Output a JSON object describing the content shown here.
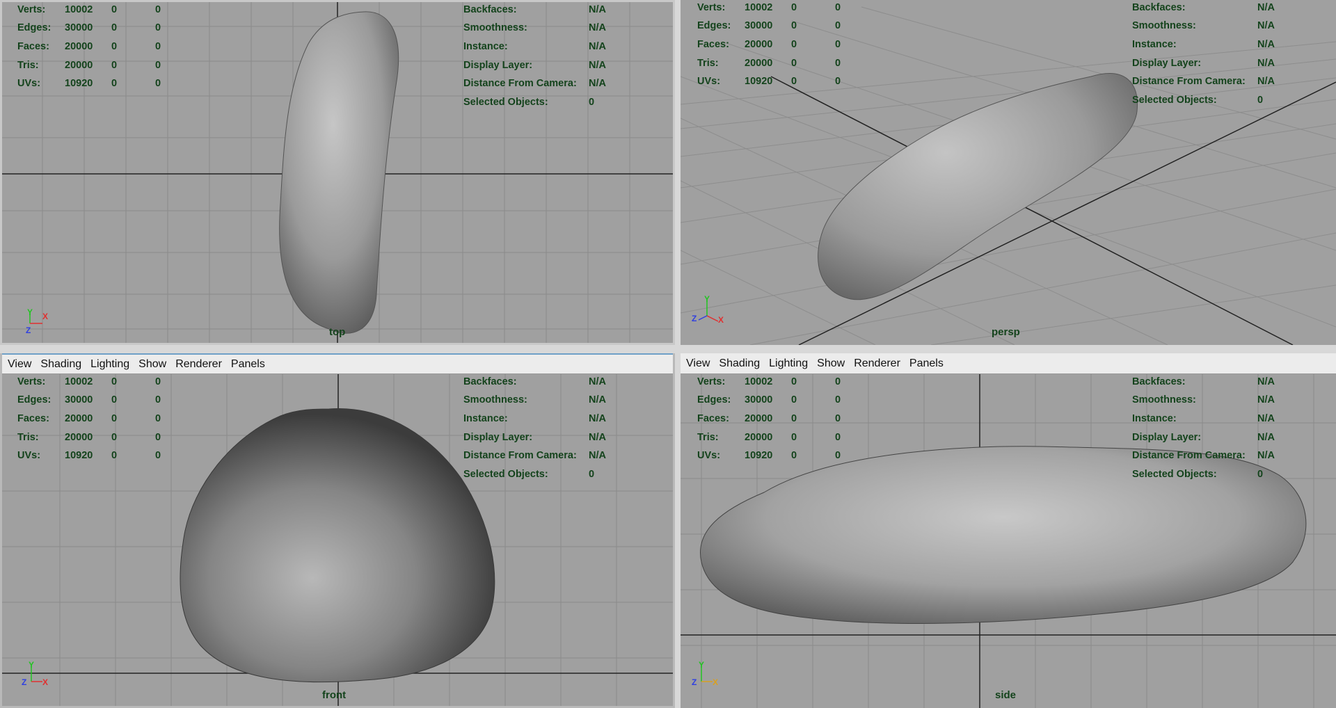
{
  "menu": [
    "View",
    "Shading",
    "Lighting",
    "Show",
    "Renderer",
    "Panels"
  ],
  "poly_stats": [
    {
      "label": "Verts:",
      "values": [
        "10002",
        "0",
        "0"
      ]
    },
    {
      "label": "Edges:",
      "values": [
        "30000",
        "0",
        "0"
      ]
    },
    {
      "label": "Faces:",
      "values": [
        "20000",
        "0",
        "0"
      ]
    },
    {
      "label": "Tris:",
      "values": [
        "20000",
        "0",
        "0"
      ]
    },
    {
      "label": "UVs:",
      "values": [
        "10920",
        "0",
        "0"
      ]
    }
  ],
  "display_stats": [
    {
      "label": "Backfaces:",
      "value": "N/A"
    },
    {
      "label": "Smoothness:",
      "value": "N/A"
    },
    {
      "label": "Instance:",
      "value": "N/A"
    },
    {
      "label": "Display Layer:",
      "value": "N/A"
    },
    {
      "label": "Distance From Camera:",
      "value": "N/A"
    },
    {
      "label": "Selected Objects:",
      "value": "0"
    }
  ],
  "viewports": {
    "top": {
      "camera": "top",
      "axes": [
        "Y",
        "X",
        "Z"
      ]
    },
    "persp": {
      "camera": "persp",
      "axes": [
        "Y",
        "Z",
        "X"
      ]
    },
    "front": {
      "camera": "front",
      "axes": [
        "Y",
        "Z",
        "X"
      ]
    },
    "side": {
      "camera": "side",
      "axes": [
        "Y",
        "Z",
        "X"
      ]
    }
  },
  "colors": {
    "viewport_bg": "#a0a0a0",
    "hud_text": "#14431c",
    "grid": "#8a8a8a",
    "axis_line": "#222222",
    "axis_x": "#e03030",
    "axis_y": "#22c422",
    "axis_z": "#3040e0"
  }
}
